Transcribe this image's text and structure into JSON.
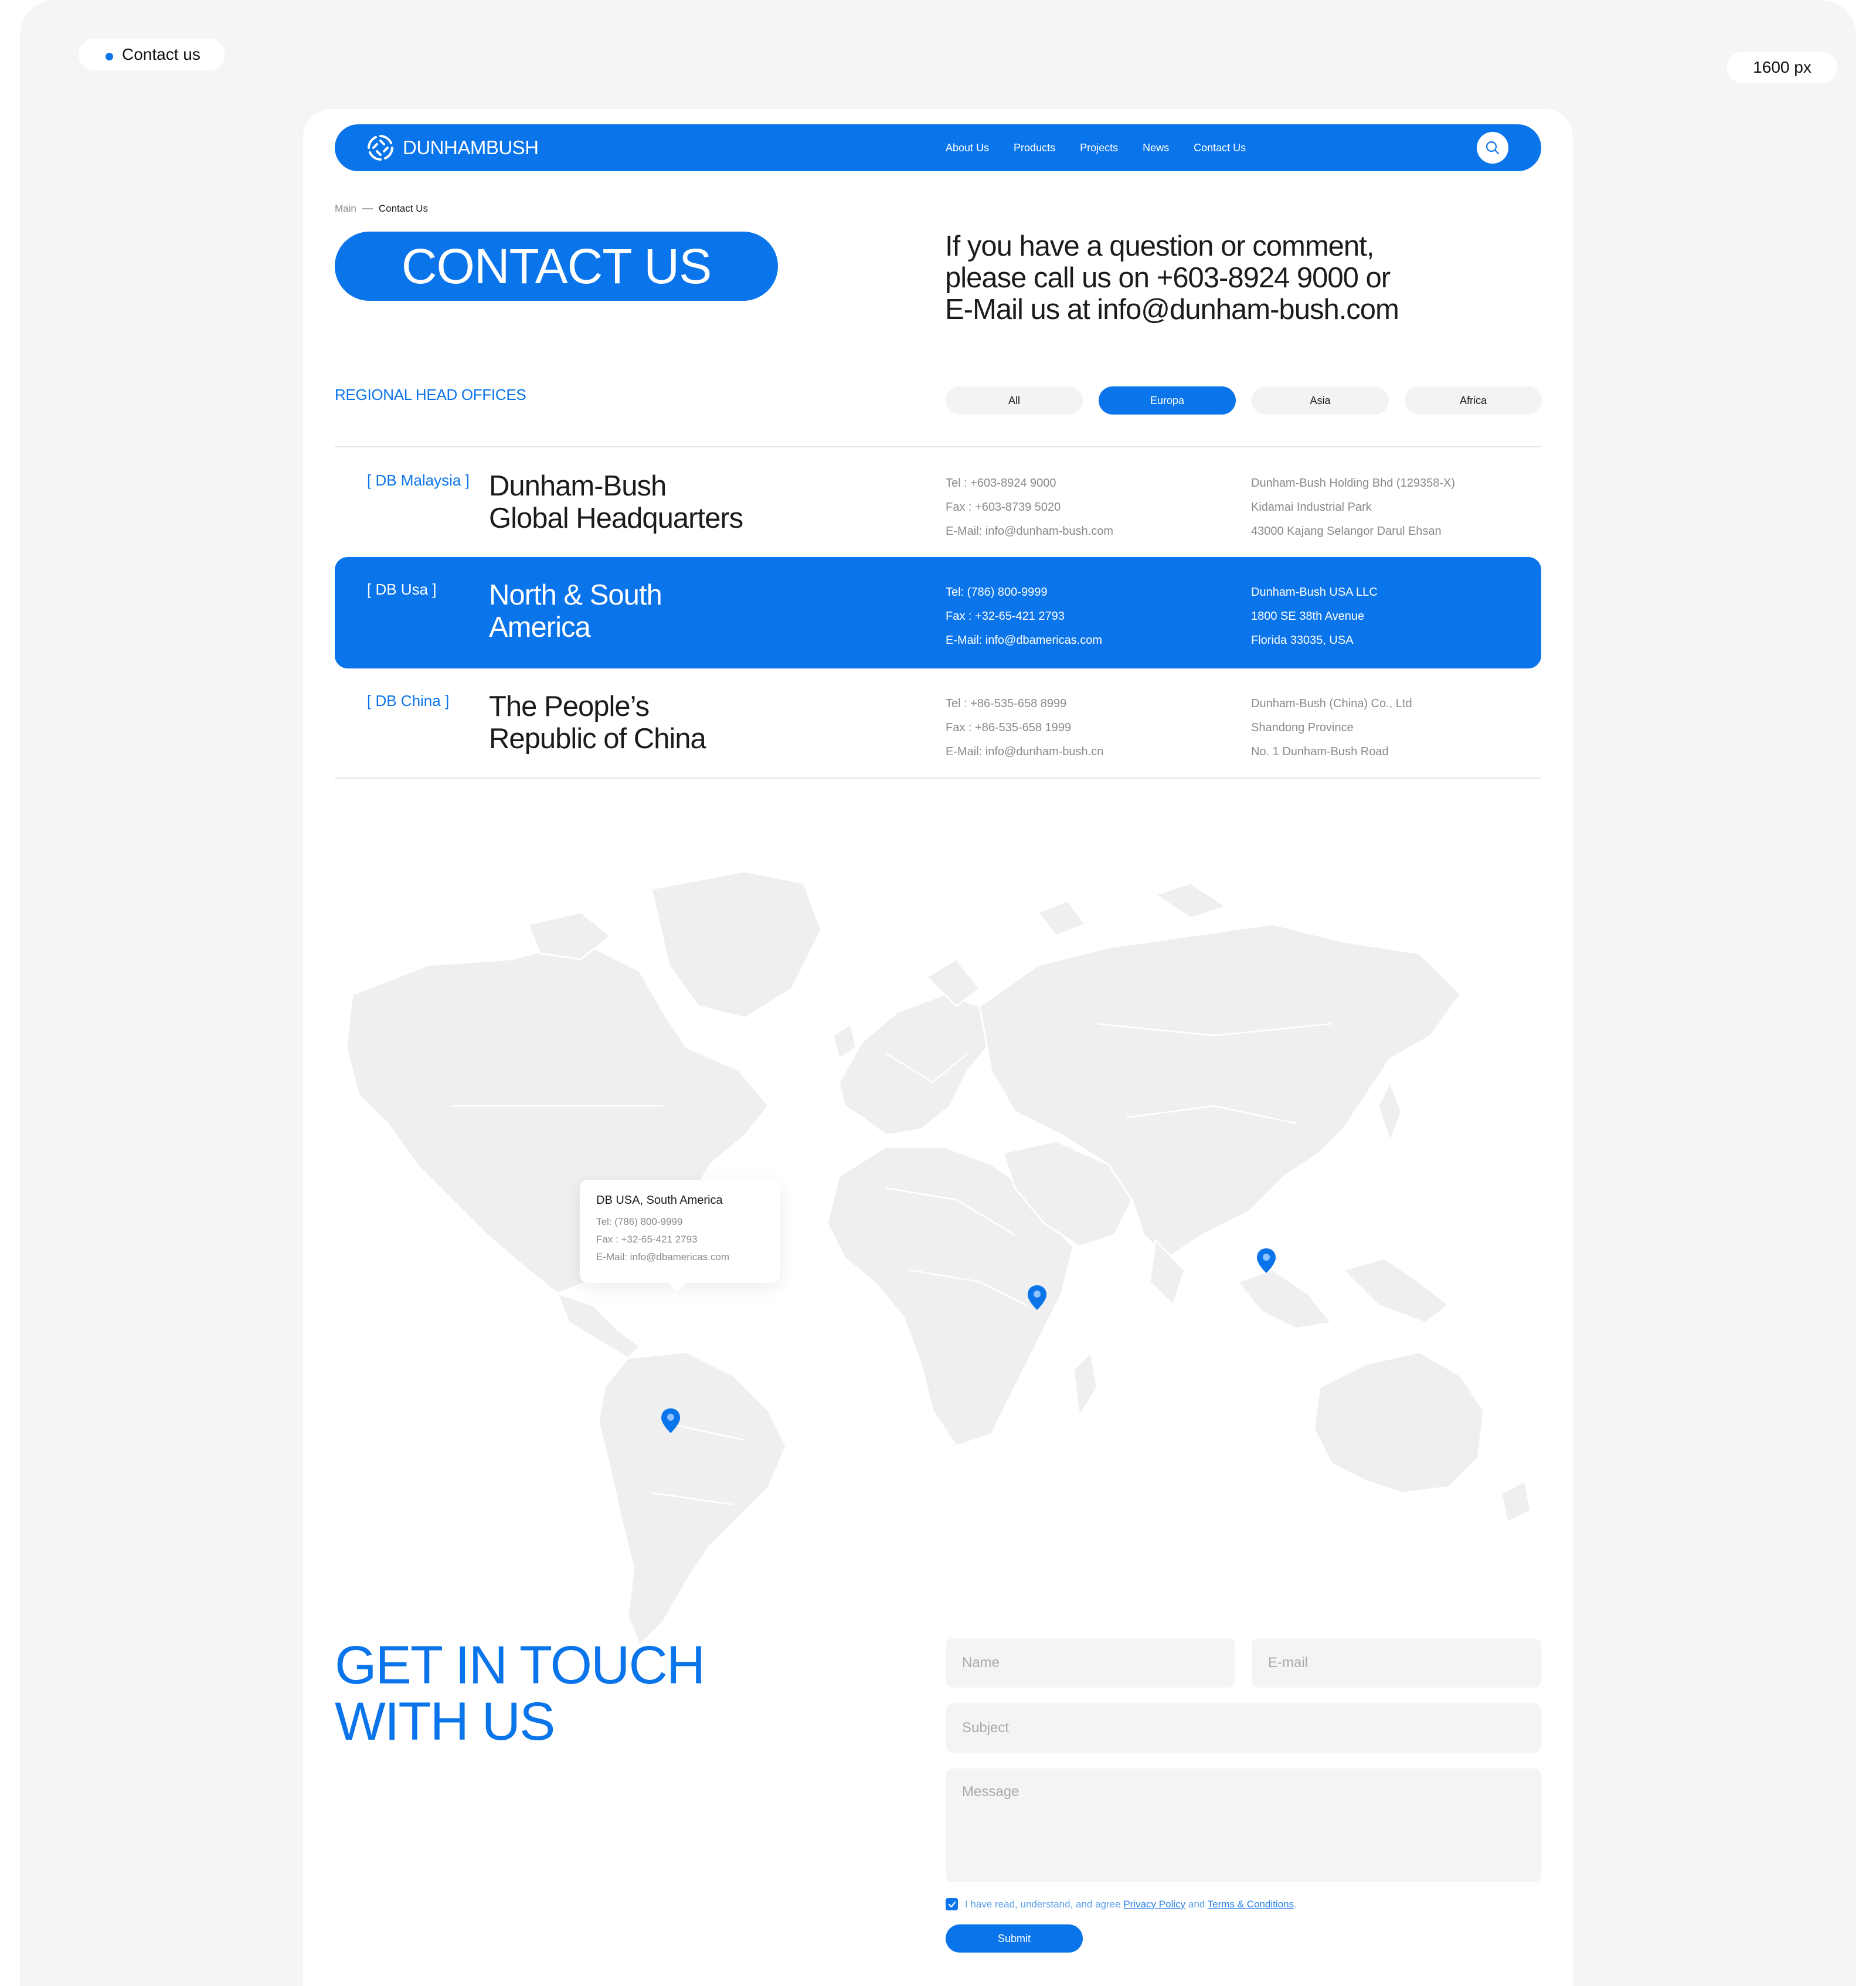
{
  "artboard": {
    "label": "Contact us",
    "size_label": "1600 px"
  },
  "brand": {
    "name": "DUNHAMBUSH",
    "accent_color": "#0a74ea"
  },
  "nav": {
    "items": [
      {
        "label": "About Us"
      },
      {
        "label": "Products"
      },
      {
        "label": "Projects"
      },
      {
        "label": "News"
      },
      {
        "label": "Contact Us"
      }
    ],
    "search_icon": "search-icon"
  },
  "breadcrumb": {
    "home": "Main",
    "current": "Contact Us"
  },
  "hero": {
    "title": "CONTACT US",
    "intro_lines": [
      "If you have a question or comment,",
      "please call us on +603-8924 9000 or",
      "E-Mail us at info@dunham-bush.com"
    ]
  },
  "offices": {
    "heading": "REGIONAL HEAD OFFICES",
    "filters": [
      {
        "label": "All",
        "active": false
      },
      {
        "label": "Europa",
        "active": true
      },
      {
        "label": "Asia",
        "active": false
      },
      {
        "label": "Africa",
        "active": false
      }
    ],
    "rows": [
      {
        "tag": "[ DB Malaysia ]",
        "name_line1": "Dunham-Bush",
        "name_line2": "Global Headquarters",
        "contact": [
          "Tel : +603-8924 9000",
          "Fax : +603-8739 5020",
          "E-Mail: info@dunham-bush.com"
        ],
        "address": [
          "Dunham-Bush Holding Bhd (129358-X)",
          "Kidamai Industrial Park",
          "43000 Kajang Selangor Darul Ehsan"
        ],
        "active": false
      },
      {
        "tag": "[ DB Usa ]",
        "name_line1": "North & South",
        "name_line2": "America",
        "contact": [
          "Tel: (786) 800-9999",
          "Fax : +32-65-421 2793",
          "E-Mail: info@dbamericas.com"
        ],
        "address": [
          "Dunham-Bush USA LLC",
          "1800 SE 38th Avenue",
          "Florida 33035, USA"
        ],
        "active": true
      },
      {
        "tag": "[ DB China ]",
        "name_line1": "The People’s",
        "name_line2": "Republic of China",
        "contact": [
          "Tel : +86-535-658 8999",
          "Fax : +86-535-658 1999",
          "E-Mail:  info@dunham-bush.cn"
        ],
        "address": [
          "Dunham-Bush (China) Co., Ltd",
          "Shandong Province",
          "No. 1 Dunham-Bush Road"
        ],
        "active": false
      }
    ]
  },
  "map": {
    "tooltip": {
      "title": "DB USA, South America",
      "lines": [
        "Tel: (786) 800-9999",
        "Fax : +32-65-421 2793",
        "E-Mail: info@dbamericas.com"
      ]
    },
    "pins": [
      "map-pin-icon",
      "map-pin-icon",
      "map-pin-icon"
    ]
  },
  "contact_form": {
    "heading_line1": "GET IN TOUCH",
    "heading_line2": "WITH US",
    "name_placeholder": "Name",
    "email_placeholder": "E-mail",
    "subject_placeholder": "Subject",
    "message_placeholder": "Message",
    "agree_text": "I have read, understand, and agree",
    "privacy_link": "Privacy Policy",
    "and_text": "and",
    "terms_link": "Terms & Conditions",
    "period": ".",
    "submit_label": "Submit"
  }
}
